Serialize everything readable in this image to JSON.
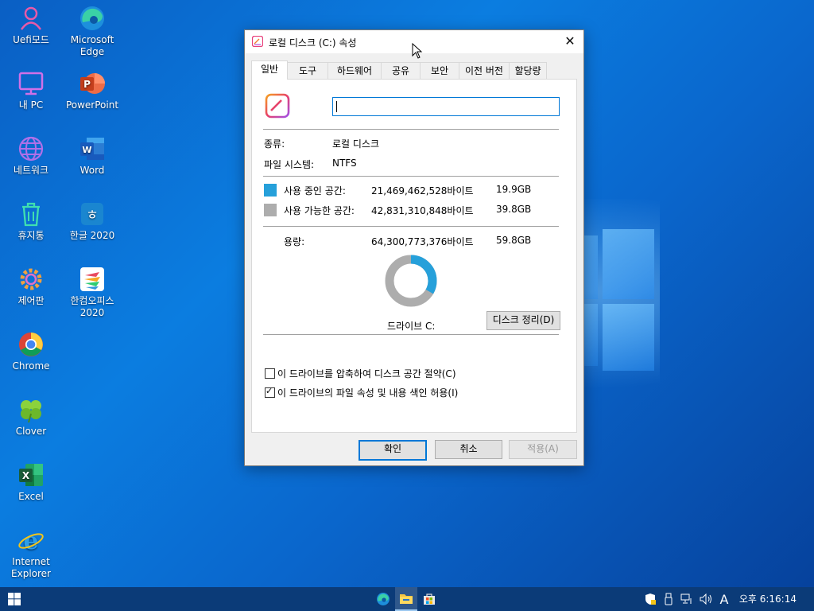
{
  "desktop": {
    "icons": [
      {
        "label": "Uefi모드",
        "icon": "user-icon"
      },
      {
        "label": "Microsoft Edge",
        "icon": "edge-icon"
      },
      {
        "label": "내 PC",
        "icon": "monitor-icon"
      },
      {
        "label": "PowerPoint",
        "icon": "powerpoint-icon"
      },
      {
        "label": "네트워크",
        "icon": "globe-icon"
      },
      {
        "label": "Word",
        "icon": "word-icon"
      },
      {
        "label": "휴지통",
        "icon": "recycle-bin-icon"
      },
      {
        "label": "한글 2020",
        "icon": "hangul-icon"
      },
      {
        "label": "제어판",
        "icon": "gear-icon"
      },
      {
        "label": "한컴오피스 2020",
        "icon": "hancom-office-icon"
      },
      {
        "label": "Chrome",
        "icon": "chrome-icon"
      },
      {
        "label": "Clover",
        "icon": "clover-icon"
      },
      {
        "label": "Excel",
        "icon": "excel-icon"
      },
      {
        "label": "Internet Explorer",
        "icon": "ie-icon"
      }
    ]
  },
  "dialog": {
    "title": "로컬 디스크 (C:) 속성",
    "tabs": [
      "일반",
      "도구",
      "하드웨어",
      "공유",
      "보안",
      "이전 버전",
      "할당량"
    ],
    "name_value": "",
    "type_label": "종류:",
    "type_value": "로컬 디스크",
    "fs_label": "파일 시스템:",
    "fs_value": "NTFS",
    "used_label": "사용 중인 공간:",
    "used_bytes": "21,469,462,528바이트",
    "used_gb": "19.9GB",
    "free_label": "사용 가능한 공간:",
    "free_bytes": "42,831,310,848바이트",
    "free_gb": "39.8GB",
    "capacity_label": "용량:",
    "capacity_bytes": "64,300,773,376바이트",
    "capacity_gb": "59.8GB",
    "used_fraction": 0.3339,
    "used_color": "#26a0da",
    "free_color": "#adadad",
    "drive_label": "드라이브 C:",
    "cleanup_button": "디스크 정리(D)",
    "compress_label": "이 드라이브를 압축하여 디스크 공간 절약(C)",
    "compress_checked": false,
    "index_label": "이 드라이브의 파일 속성 및 내용 색인 허용(I)",
    "index_checked": true,
    "ok_button": "확인",
    "cancel_button": "취소",
    "apply_button": "적용(A)"
  },
  "taskbar": {
    "clock": "오후 6:16:14",
    "ime": "A",
    "pinned": [
      "edge-icon",
      "file-explorer-icon",
      "store-icon"
    ]
  }
}
